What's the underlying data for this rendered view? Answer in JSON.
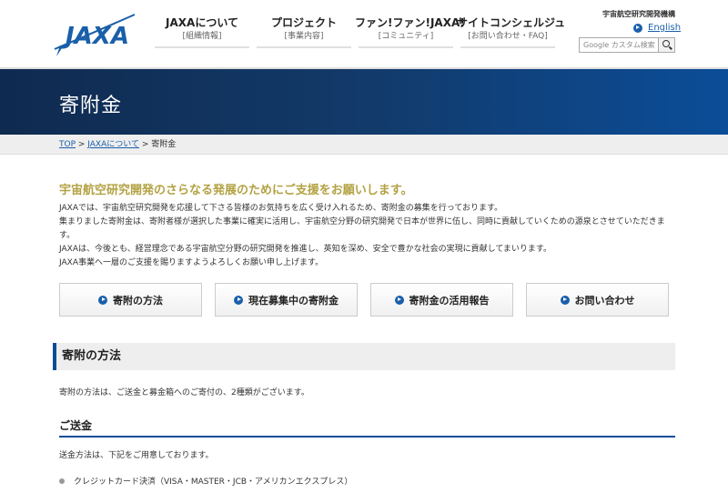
{
  "header": {
    "logo_text": "JAXA",
    "org_name": "宇宙航空研究開発機構",
    "english_link": "English",
    "search_placeholder": "Google カスタム検索",
    "nav": [
      {
        "label": "JAXAについて",
        "sub": "[組織情報]"
      },
      {
        "label": "プロジェクト",
        "sub": "[事業内容]"
      },
      {
        "label": "ファン!ファン!JAXA!",
        "sub": "[コミュニティ]"
      },
      {
        "label": "サイトコンシェルジュ",
        "sub": "[お問い合わせ・FAQ]"
      }
    ]
  },
  "banner": {
    "title": "寄附金"
  },
  "breadcrumb": {
    "top": "TOP",
    "sep1": " > ",
    "about": "JAXAについて",
    "sep2": " > ",
    "current": "寄附金"
  },
  "intro": {
    "lead": "宇宙航空研究開発のさらなる発展のためにご支援をお願いします。",
    "lines": [
      "JAXAでは、宇宙航空研究開発を応援して下さる皆様のお気持ちを広く受け入れるため、寄附金の募集を行っております。",
      "集まりました寄附金は、寄附者様が選択した事業に確実に活用し、宇宙航空分野の研究開発で日本が世界に伍し、同時に貢献していくための源泉とさせていただきます。",
      "JAXAは、今後とも、経営理念である宇宙航空分野の研究開発を推進し、英知を深め、安全で豊かな社会の実現に貢献してまいります。",
      "JAXA事業へ一層のご支援を賜りますようよろしくお願い申し上げます。"
    ]
  },
  "buttons": [
    "寄附の方法",
    "現在募集中の寄附金",
    "寄附金の活用報告",
    "お問い合わせ"
  ],
  "section1": {
    "title": "寄附の方法",
    "text": "寄附の方法は、ご送金と募金箱へのご寄付の、2種類がございます。"
  },
  "section2": {
    "title": "ご送金",
    "text": "送金方法は、下記をご用意しております。"
  },
  "bullets": [
    "クレジットカード決済（VISA・MASTER・JCB・アメリカンエクスプレス）"
  ],
  "colors": {
    "accent": "#0b4d98",
    "lead": "#b3a243",
    "link": "#1a5faa"
  }
}
